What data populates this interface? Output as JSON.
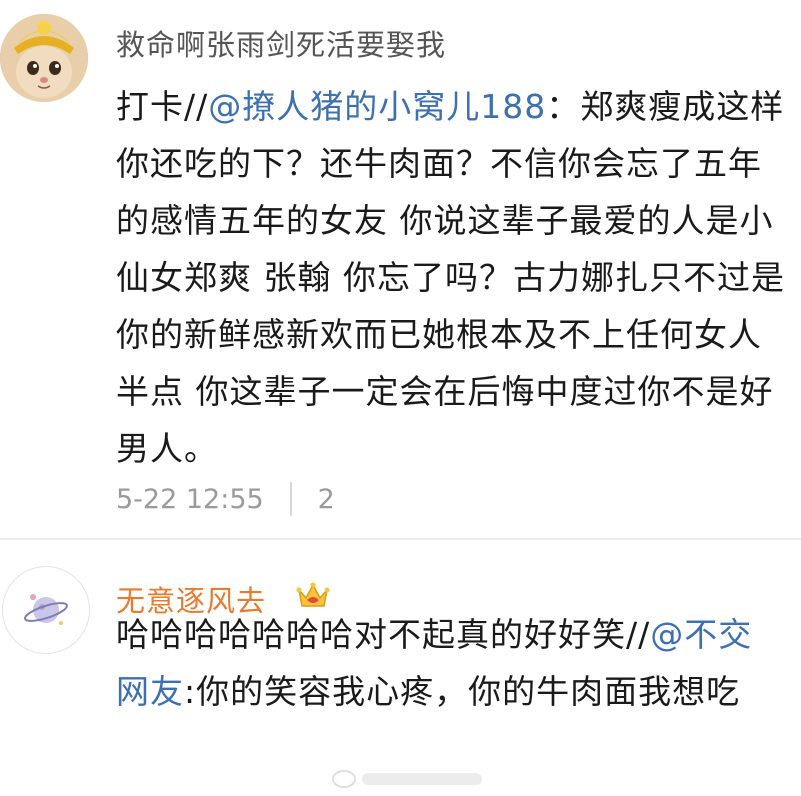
{
  "comments": [
    {
      "author": "救命啊张雨剑死活要娶我",
      "text_prefix": "打卡//",
      "mention": "@撩人猪的小窝儿188",
      "text": "：郑爽瘦成这样你还吃的下？还牛肉面？不信你会忘了五年的感情五年的女友 你说这辈子最爱的人是小仙女郑爽 张翰 你忘了吗？古力娜扎只不过是你的新鲜感新欢而已她根本及不上任何女人半点 你这辈子一定会在后悔中度过你不是好男人。",
      "timestamp": "5-22 12:55",
      "reply_count": "2"
    },
    {
      "author": "无意逐风去",
      "text_prefix": "哈哈哈哈哈哈哈对不起真的好好笑//",
      "mention": "@不交网友",
      "text": ":你的笑容我心疼，你的牛肉面我想吃"
    }
  ],
  "colors": {
    "mention": "#3d70b2",
    "vip_name": "#e87a30",
    "meta": "#9a9a9a"
  },
  "icons": {
    "vip_badge": "crown-icon",
    "avatar_2": "planet-icon"
  }
}
